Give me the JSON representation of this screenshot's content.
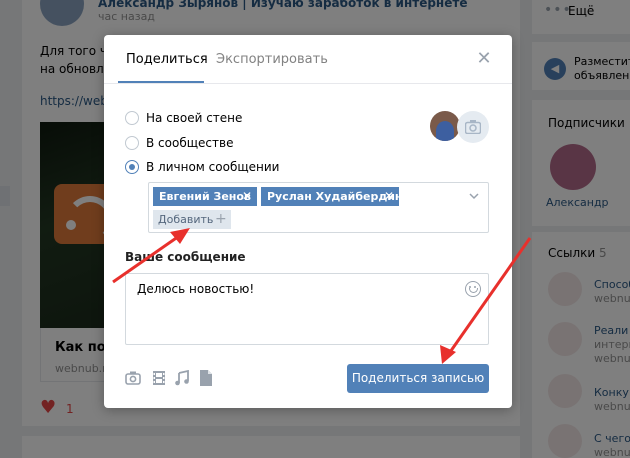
{
  "background": {
    "post": {
      "author": "Александр Зырянов | Изучаю заработок в интернете",
      "time": "час назад",
      "text_line1": "Для того чтобы",
      "text_line2": "на обновления",
      "link": "https://webnub",
      "card_title": "Как под",
      "card_site": "webnub.r",
      "likes": "1"
    },
    "right": {
      "more_label": "Ещё",
      "promo_line1": "Разместит",
      "promo_line2": "объявлени",
      "subscribers_title": "Подписчики",
      "subscriber_name": "Александр",
      "links_title": "Ссылки",
      "links_count": "5",
      "links": [
        {
          "title": "Способ",
          "sub": "webnub"
        },
        {
          "title": "Реали",
          "sub": "интерн"
        },
        {
          "title": "webnub",
          "sub": ""
        },
        {
          "title": "Конку",
          "sub": "webnub"
        },
        {
          "title": "С чего",
          "sub": "webnub"
        }
      ]
    }
  },
  "modal": {
    "tabs": [
      {
        "label": "Поделиться",
        "active": true
      },
      {
        "label": "Экспортировать",
        "active": false
      }
    ],
    "share_targets": [
      {
        "label": "На своей стене",
        "checked": false
      },
      {
        "label": "В сообществе",
        "checked": false
      },
      {
        "label": "В личном сообщении",
        "checked": true
      }
    ],
    "recipients": [
      "Евгений Зенов",
      "Руслан Худайбердин"
    ],
    "add_label": "Добавить",
    "message_label": "Ваше сообщение",
    "message_value": "Делюсь новостью!",
    "submit_label": "Поделиться записью",
    "attach_icons": [
      "camera-icon",
      "video-icon",
      "music-icon",
      "document-icon"
    ]
  },
  "colors": {
    "accent": "#5181b8",
    "annotation_arrow": "#e8302c"
  }
}
